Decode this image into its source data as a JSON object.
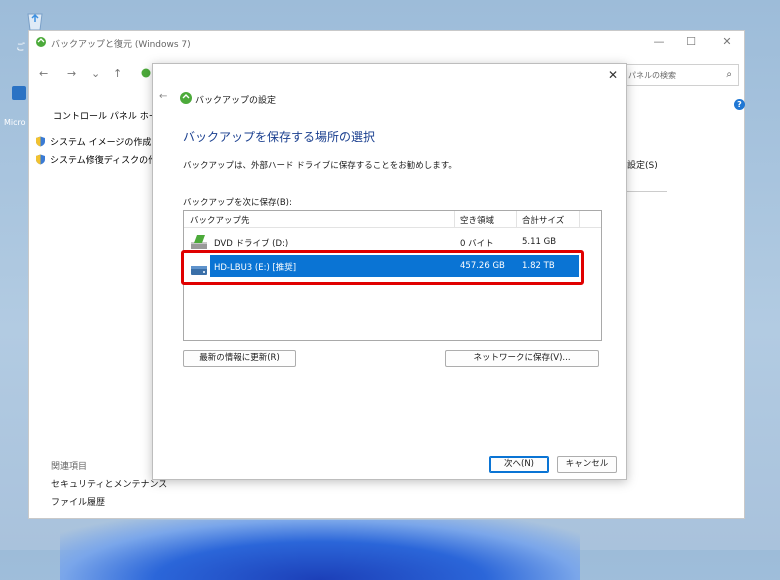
{
  "desktop": {
    "recycle_label": "ご",
    "edge_label": "Micro"
  },
  "parent_window": {
    "title": "バックアップと復元 (Windows 7)",
    "controls": {
      "minimize": "—",
      "maximize": "☐",
      "close": "✕"
    },
    "nav": {
      "back": "←",
      "forward": "→",
      "recent": "⌄",
      "up": "↑"
    },
    "search_placeholder": "パネルの検索",
    "search_icon": "⌕",
    "sidebar": {
      "home": "コントロール パネル ホーム",
      "links": [
        "システム イメージの作成",
        "システム修復ディスクの作成"
      ],
      "related_heading": "関連項目",
      "related_links": [
        "セキュリティとメンテナンス",
        "ファイル履歴"
      ]
    },
    "right_link": "設定(S)",
    "info_icon": "?"
  },
  "dialog": {
    "close": "✕",
    "back": "←",
    "title": "バックアップの設定",
    "heading": "バックアップを保存する場所の選択",
    "description": "バックアップは、外部ハード ドライブに保存することをお勧めします。",
    "list_label": "バックアップを次に保存(B):",
    "columns": [
      "バックアップ先",
      "空き領域",
      "合計サイズ"
    ],
    "rows": [
      {
        "name": "DVD ドライブ (D:)",
        "free": "0 バイト",
        "total": "5.11 GB",
        "icon": "dvd-drive-icon",
        "selected": false
      },
      {
        "name": "HD-LBU3 (E:) [推奨]",
        "free": "457.26 GB",
        "total": "1.82 TB",
        "icon": "hard-drive-icon",
        "selected": true
      }
    ],
    "refresh_button": "最新の情報に更新(R)",
    "network_button": "ネットワークに保存(V)...",
    "next_button": "次へ(N)",
    "cancel_button": "キャンセル"
  },
  "colors": {
    "selection": "#0a74d4",
    "highlight": "#e00000",
    "heading": "#1a3f8f"
  }
}
